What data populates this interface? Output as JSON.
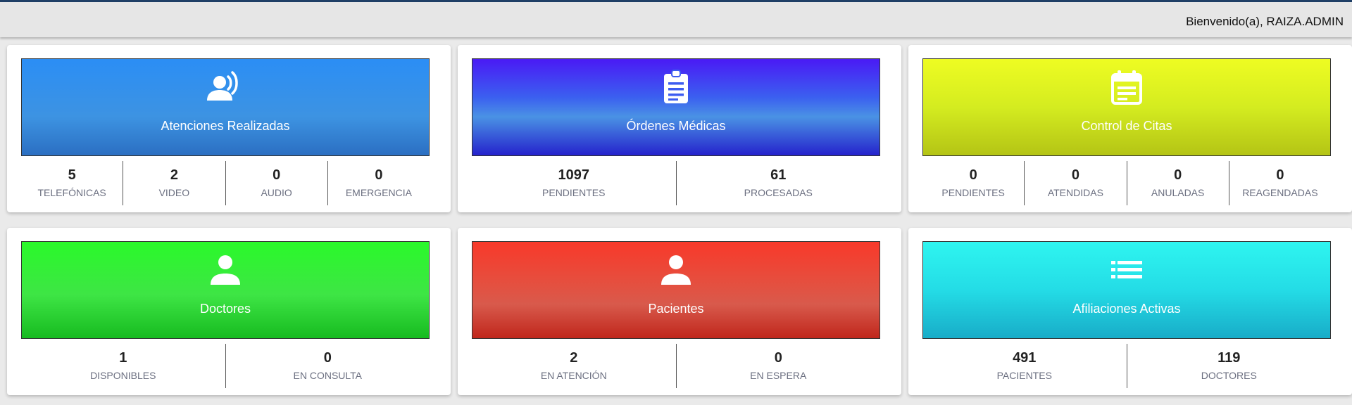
{
  "header": {
    "welcome": "Bienvenido(a), RAIZA.ADMIN"
  },
  "cards": [
    {
      "title": "Atenciones Realizadas",
      "icon": "person-voice-icon",
      "gradient": [
        "#2b8ef5",
        "#2b6fc2"
      ],
      "stats": [
        {
          "value": "5",
          "label": "TELEFÓNICAS"
        },
        {
          "value": "2",
          "label": "VIDEO"
        },
        {
          "value": "0",
          "label": "AUDIO"
        },
        {
          "value": "0",
          "label": "EMERGENCIA"
        }
      ]
    },
    {
      "title": "Órdenes Médicas",
      "icon": "clipboard-icon",
      "gradient": [
        "#4a1af5",
        "#2522cc"
      ],
      "stats": [
        {
          "value": "1097",
          "label": "PENDIENTES"
        },
        {
          "value": "61",
          "label": "PROCESADAS"
        }
      ]
    },
    {
      "title": "Control de Citas",
      "icon": "calendar-icon",
      "gradient": [
        "#eefc22",
        "#b4c415"
      ],
      "stats": [
        {
          "value": "0",
          "label": "PENDIENTES"
        },
        {
          "value": "0",
          "label": "ATENDIDAS"
        },
        {
          "value": "0",
          "label": "ANULADAS"
        },
        {
          "value": "0",
          "label": "REAGENDADAS"
        }
      ]
    },
    {
      "title": "Doctores",
      "icon": "person-icon",
      "gradient": [
        "#2af92a",
        "#17bb20"
      ],
      "stats": [
        {
          "value": "1",
          "label": "DISPONIBLES"
        },
        {
          "value": "0",
          "label": "EN CONSULTA"
        }
      ]
    },
    {
      "title": "Pacientes",
      "icon": "person-icon",
      "gradient": [
        "#f8392a",
        "#c0261c"
      ],
      "stats": [
        {
          "value": "2",
          "label": "EN ATENCIÓN"
        },
        {
          "value": "0",
          "label": "EN ESPERA"
        }
      ]
    },
    {
      "title": "Afiliaciones Activas",
      "icon": "list-icon",
      "gradient": [
        "#2ef5f0",
        "#18acc8"
      ],
      "stats": [
        {
          "value": "491",
          "label": "PACIENTES"
        },
        {
          "value": "119",
          "label": "DOCTORES"
        }
      ]
    }
  ]
}
